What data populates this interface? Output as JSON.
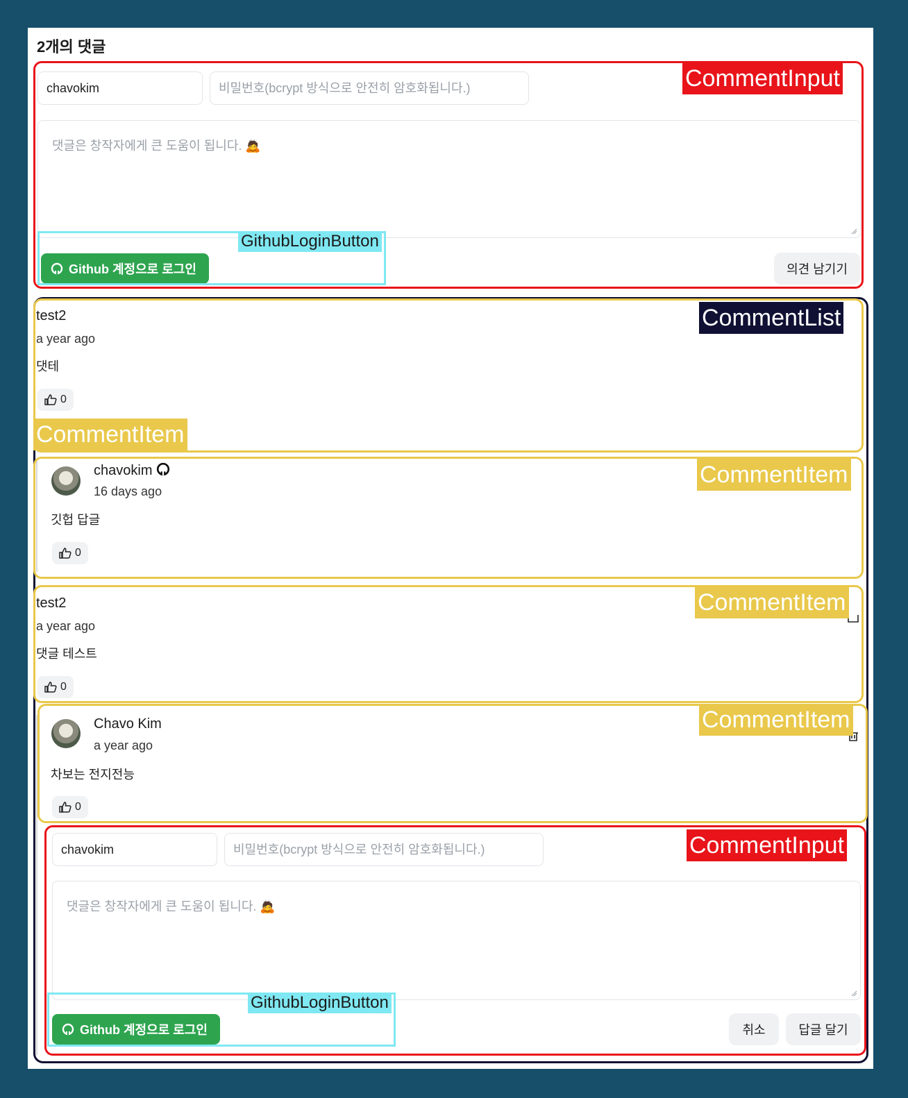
{
  "page": {
    "title": "2개의 댓글"
  },
  "comment_input_top": {
    "username_value": "chavokim",
    "password_placeholder": "비밀번호(bcrypt 방식으로 안전히 암호화됩니다.)",
    "textarea_placeholder": "댓글은 창작자에게 큰 도움이 됩니다. 🙇",
    "github_button_label": "Github 계정으로 로그인",
    "submit_label": "의견 남기기"
  },
  "comments": [
    {
      "author": "test2",
      "time": "a year ago",
      "body": "댓테",
      "likes": "0"
    },
    {
      "author": "chavokim",
      "time": "16 days ago",
      "body": "깃헙 답글",
      "likes": "0"
    },
    {
      "author": "test2",
      "time": "a year ago",
      "body": "댓글 테스트",
      "likes": "0"
    },
    {
      "author": "Chavo Kim",
      "time": "a year ago",
      "body": "차보는 전지전능",
      "likes": "0"
    }
  ],
  "comment_input_reply": {
    "username_value": "chavokim",
    "password_placeholder": "비밀번호(bcrypt 방식으로 안전히 암호화됩니다.)",
    "textarea_placeholder": "댓글은 창작자에게 큰 도움이 됩니다. 🙇",
    "github_button_label": "Github 계정으로 로그인",
    "cancel_label": "취소",
    "submit_label": "답글 달기"
  },
  "annotations": {
    "comment_input": "CommentInput",
    "github_login_button": "GithubLoginButton",
    "comment_list": "CommentList",
    "comment_item": "CommentItem"
  },
  "colors": {
    "background": "#174f6b",
    "github_green": "#2ea44f",
    "annotation_red": "#e8141a",
    "annotation_yellow": "#e9c84b",
    "annotation_navy": "#0f1033",
    "annotation_cyan": "#7fe8f2"
  }
}
